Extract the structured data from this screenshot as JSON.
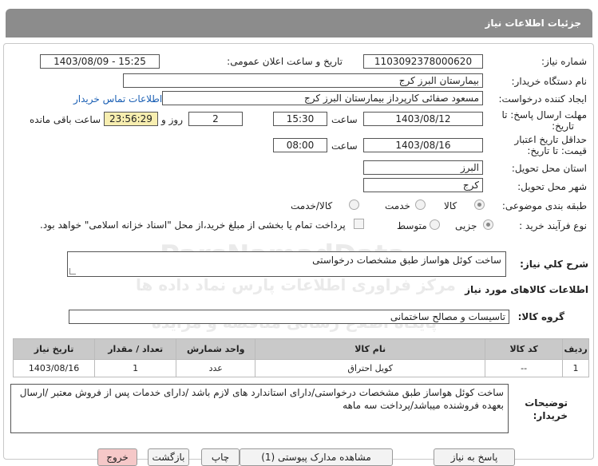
{
  "header": {
    "title": "جزئیات اطلاعات نیاز"
  },
  "form": {
    "need_number_label": "شماره نیاز:",
    "need_number": "1103092378000620",
    "announce_label": "تاریخ و ساعت اعلان عمومی:",
    "announce_value": "1403/08/09 - 15:25",
    "buyer_org_label": "نام دستگاه خریدار:",
    "buyer_org": "بیمارستان البرز کرج",
    "creator_label": "ایجاد کننده درخواست:",
    "creator": "مسعود صفائی کارپرداز بیمارستان البرز کرج",
    "contact_link": "اطلاعات تماس خریدار",
    "deadline_label_1": "مهلت ارسال پاسخ: تا",
    "deadline_label_2": "تاریخ:",
    "deadline_date": "1403/08/12",
    "time_label": "ساعت",
    "deadline_time": "15:30",
    "days_value": "2",
    "days_label": "روز و",
    "remaining_value": "23:56:29",
    "remaining_label": "ساعت باقی مانده",
    "validity_label_1": "حداقل تاریخ اعتبار",
    "validity_label_2": "قیمت: تا تاریخ:",
    "validity_date": "1403/08/16",
    "validity_time_label": "ساعت",
    "validity_time": "08:00",
    "province_label": "استان محل تحویل:",
    "province": "البرز",
    "city_label": "شهر محل تحویل:",
    "city": "کرج",
    "category_label": "طبقه بندی موضوعی:",
    "category_options": [
      "کالا",
      "خدمت",
      "کالا/خدمت"
    ],
    "process_label": "نوع فرآیند خرید :",
    "process_options": [
      "جزیی",
      "متوسط"
    ],
    "payment_note": "پرداخت تمام یا بخشی از مبلغ خرید،از محل \"اسناد خزانه اسلامی\" خواهد بود."
  },
  "summary": {
    "label": "شرح کلي نياز:",
    "text": "ساخت کوئل هواساز طبق مشخصات درخواستی"
  },
  "goods_section": {
    "title": "اطلاعات کالاهای مورد نیاز",
    "group_label": "گروه کالا:",
    "group_value": "تاسیسات و مصالح ساختمانی"
  },
  "table": {
    "headers": [
      "ردیف",
      "کد کالا",
      "نام کالا",
      "واحد شمارش",
      "تعداد / مقدار",
      "تاریخ نیاز"
    ],
    "rows": [
      [
        "1",
        "--",
        "کویل احتراق",
        "عدد",
        "1",
        "1403/08/16"
      ]
    ]
  },
  "notes": {
    "label_1": "توضیحات",
    "label_2": "خریدار:",
    "text": "ساخت کوئل هواساز طبق مشخصات درخواستی/دارای استاندارد های لازم باشد /دارای خدمات پس از فروش معتبر /ارسال بعهده فروشنده میباشد/پرداخت سه ماهه"
  },
  "buttons": {
    "reply": "پاسخ به نیاز",
    "attachments": "مشاهده مدارک پیوستی (1)",
    "print": "چاپ",
    "back": "بازگشت",
    "exit": "خروج"
  },
  "watermark": {
    "line1": "ParsNamadData",
    "line2": "مرکز فراوری اطلاعات پارس نماد داده ها",
    "line3": "پایگاه اطلاع رسانی مناقصه و مزایده",
    "line4": "۰۲۱-۸۸۳۴۹۶۷۰-۵"
  },
  "colors": {
    "header_bg": "#8c8c8c",
    "table_header_bg": "#c9c9c9",
    "remaining_bg": "#f7eeb0",
    "link": "#1a5fb4",
    "exit_bg": "#f5c8c8"
  }
}
